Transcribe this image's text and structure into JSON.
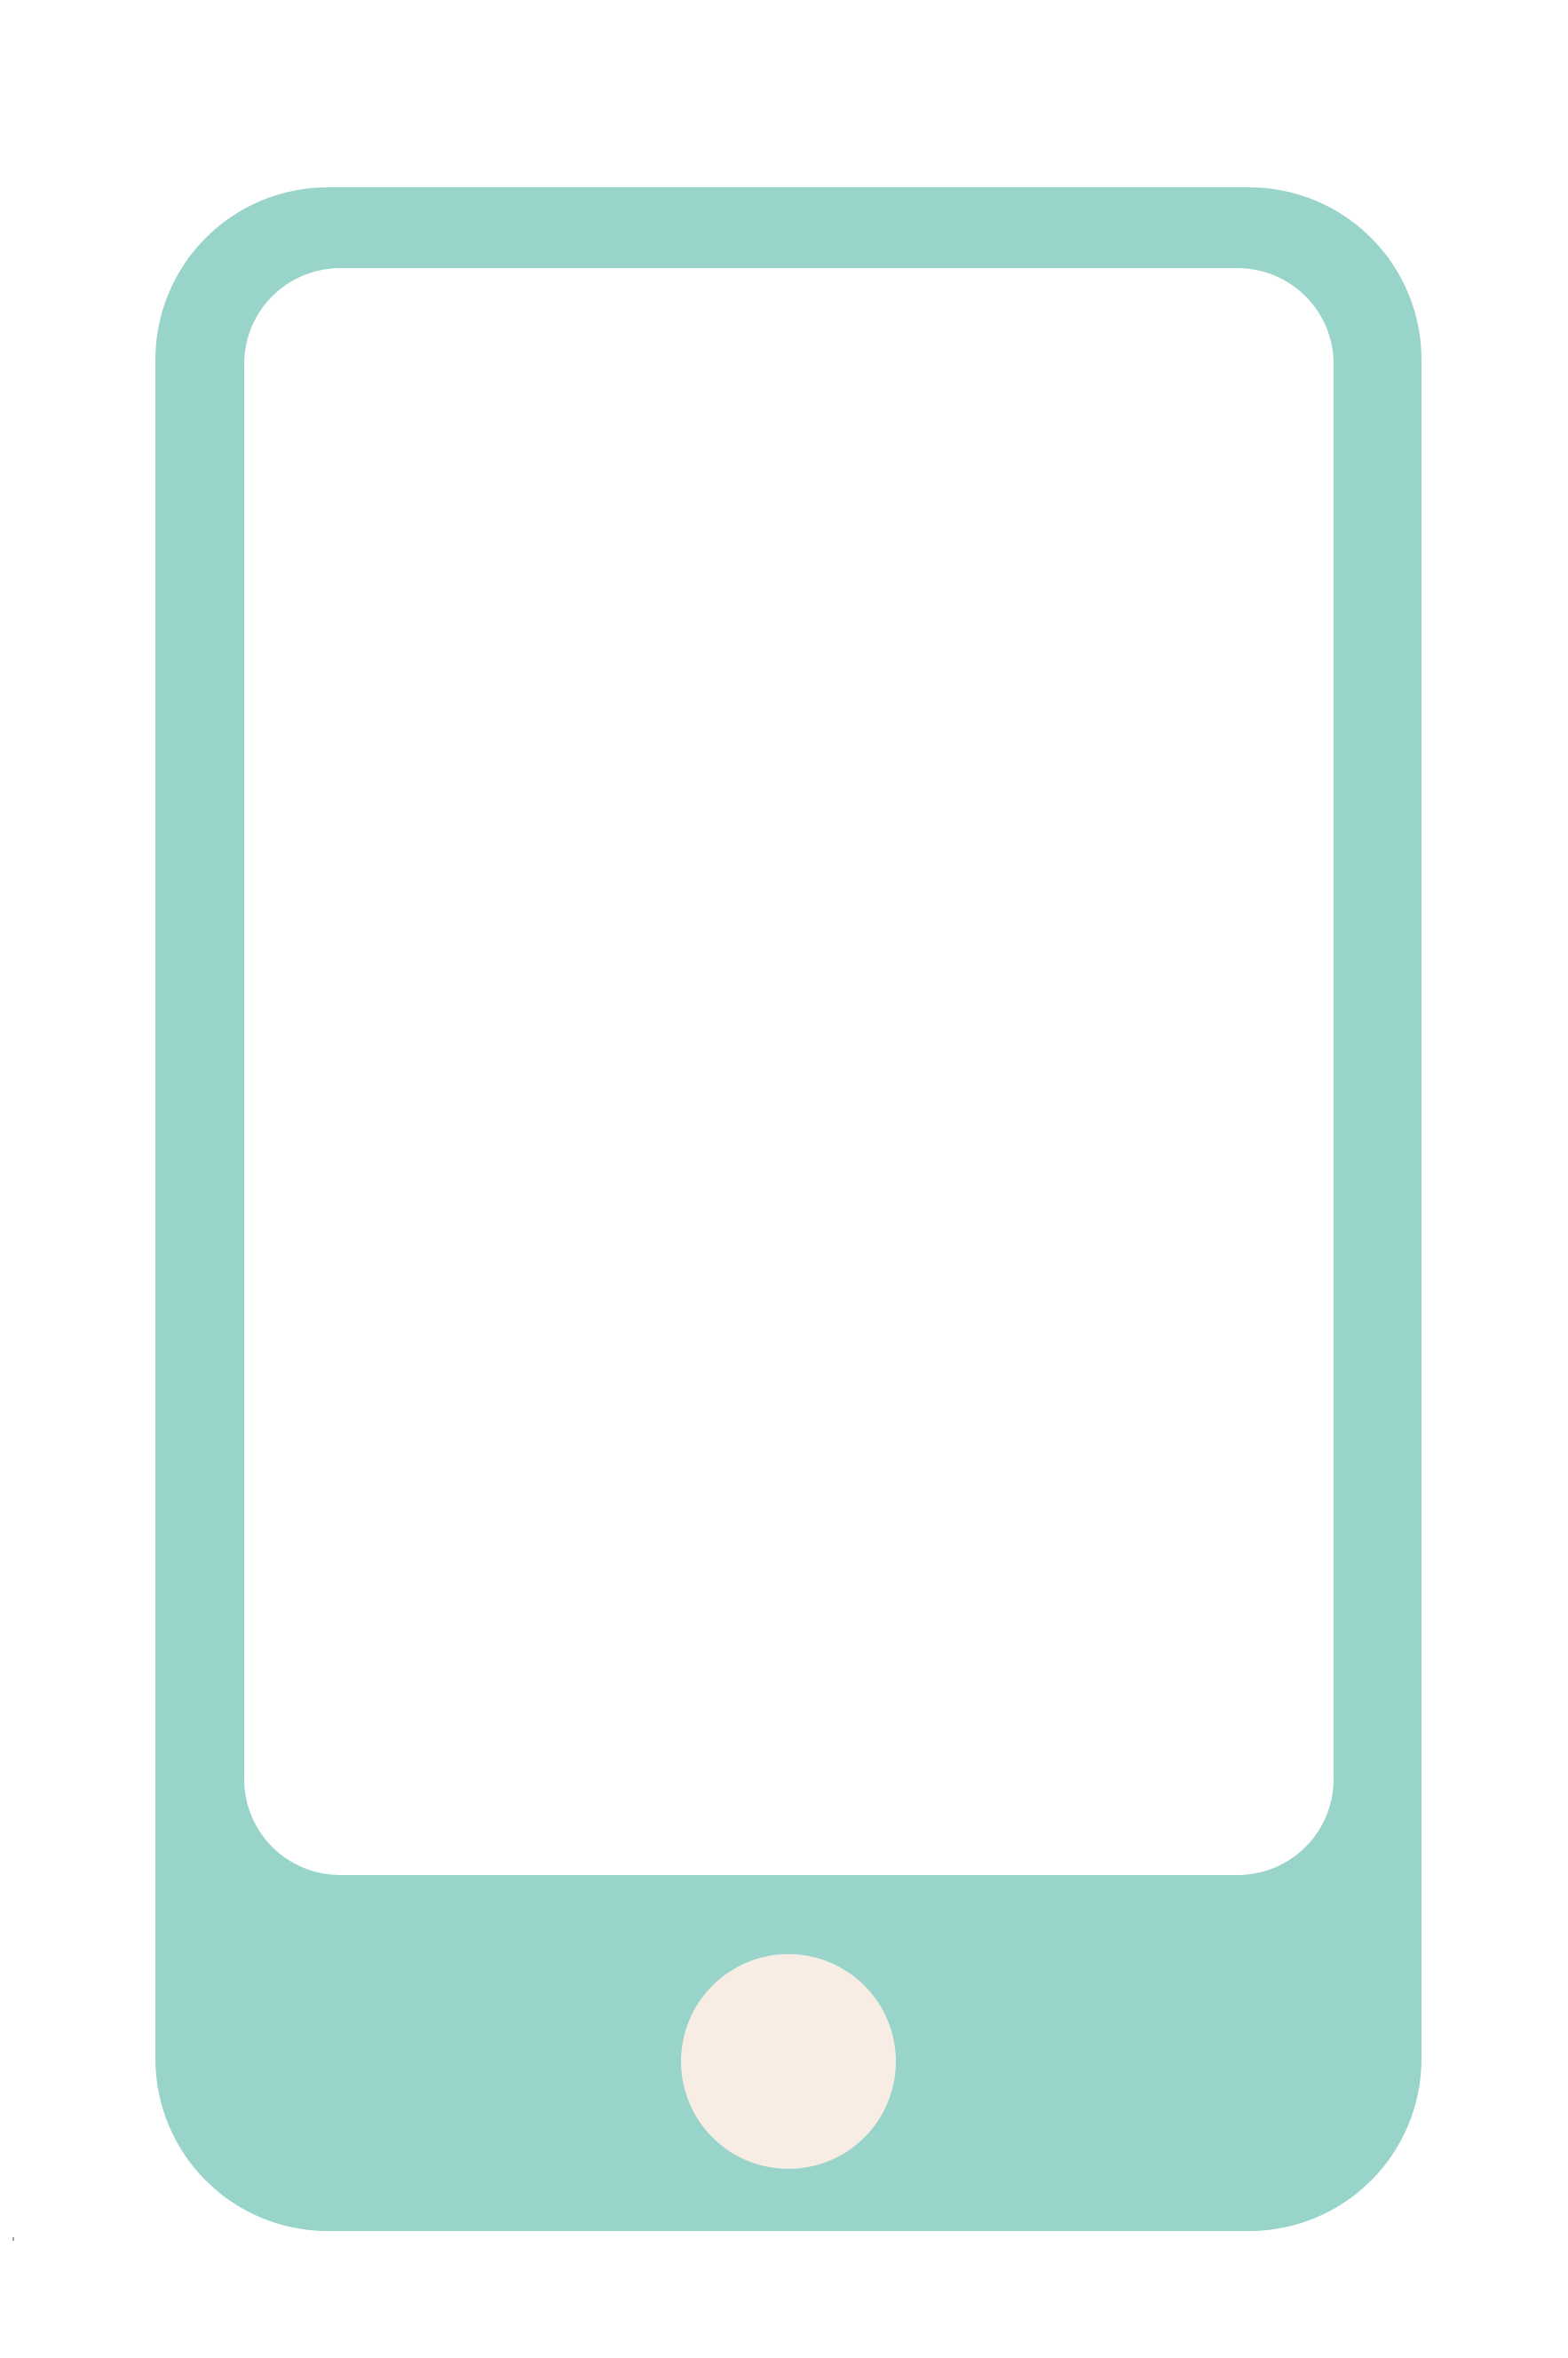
{
  "illustration": {
    "icon": "smartphone-icon",
    "colors": {
      "background": "#ffffff",
      "phone_body": "#98d4c9",
      "screen": "#ffffff",
      "home_button": "#f7ede5",
      "corner_dot": "#9aa7a4"
    }
  }
}
